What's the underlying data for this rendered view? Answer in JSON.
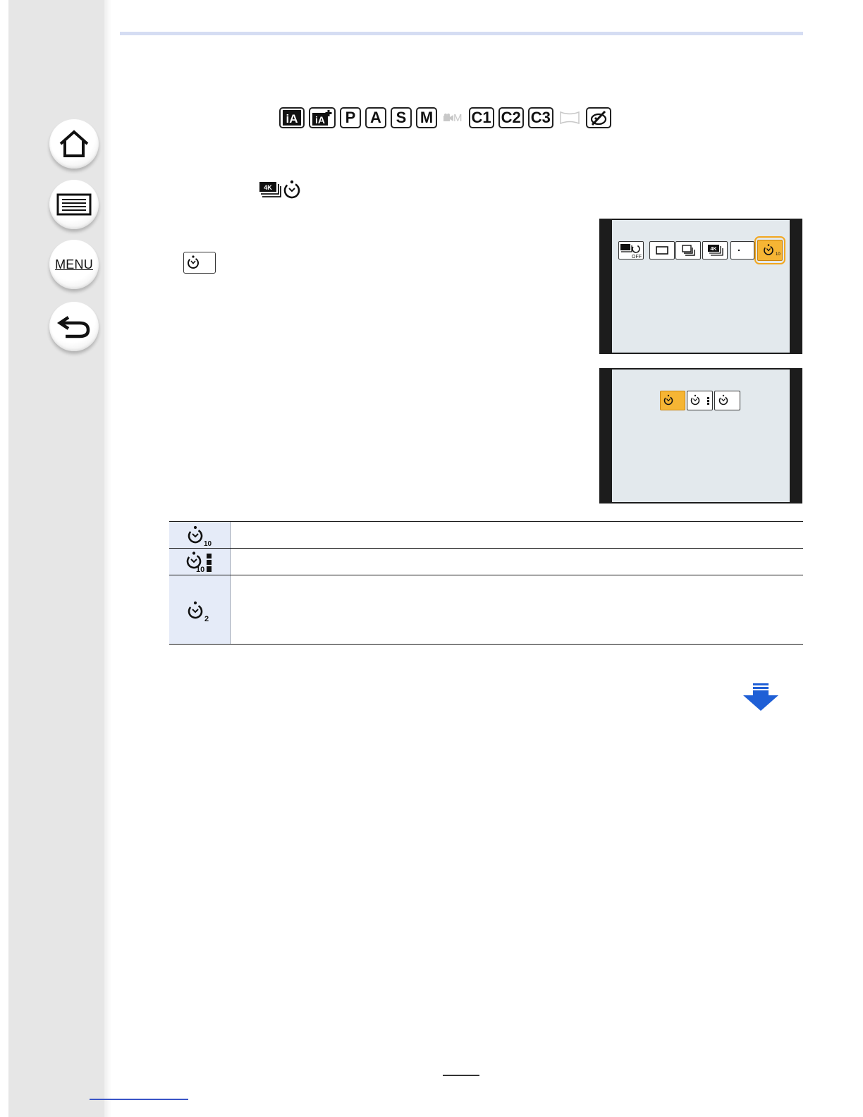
{
  "sidebar": {
    "items": [
      {
        "name": "home",
        "icon": "home-icon"
      },
      {
        "name": "contents",
        "icon": "list-icon"
      },
      {
        "name": "menu",
        "label": "MENU"
      },
      {
        "name": "back",
        "icon": "back-arrow-icon"
      }
    ]
  },
  "modes": [
    {
      "label": "iA",
      "kind": "ia"
    },
    {
      "label": "iA+",
      "kind": "ia-plus"
    },
    {
      "label": "P"
    },
    {
      "label": "A"
    },
    {
      "label": "S"
    },
    {
      "label": "M"
    },
    {
      "label": "M",
      "kind": "disabled-movie"
    },
    {
      "label": "C1"
    },
    {
      "label": "C2"
    },
    {
      "label": "C3"
    },
    {
      "label": "",
      "kind": "disabled-panorama"
    },
    {
      "label": "",
      "kind": "creative"
    }
  ],
  "timer_options": [
    {
      "icon": "self-timer-10s-icon",
      "sub": "10"
    },
    {
      "icon": "self-timer-10s-3-pictures-icon",
      "sub": "10"
    },
    {
      "icon": "self-timer-2s-icon",
      "sub": "2"
    }
  ],
  "colors": {
    "accent_orange": "#f6b534",
    "table_icon_bg": "#e5ebf8",
    "arrow_blue": "#1f5fd6",
    "rule_blue": "#d5ddf3"
  }
}
